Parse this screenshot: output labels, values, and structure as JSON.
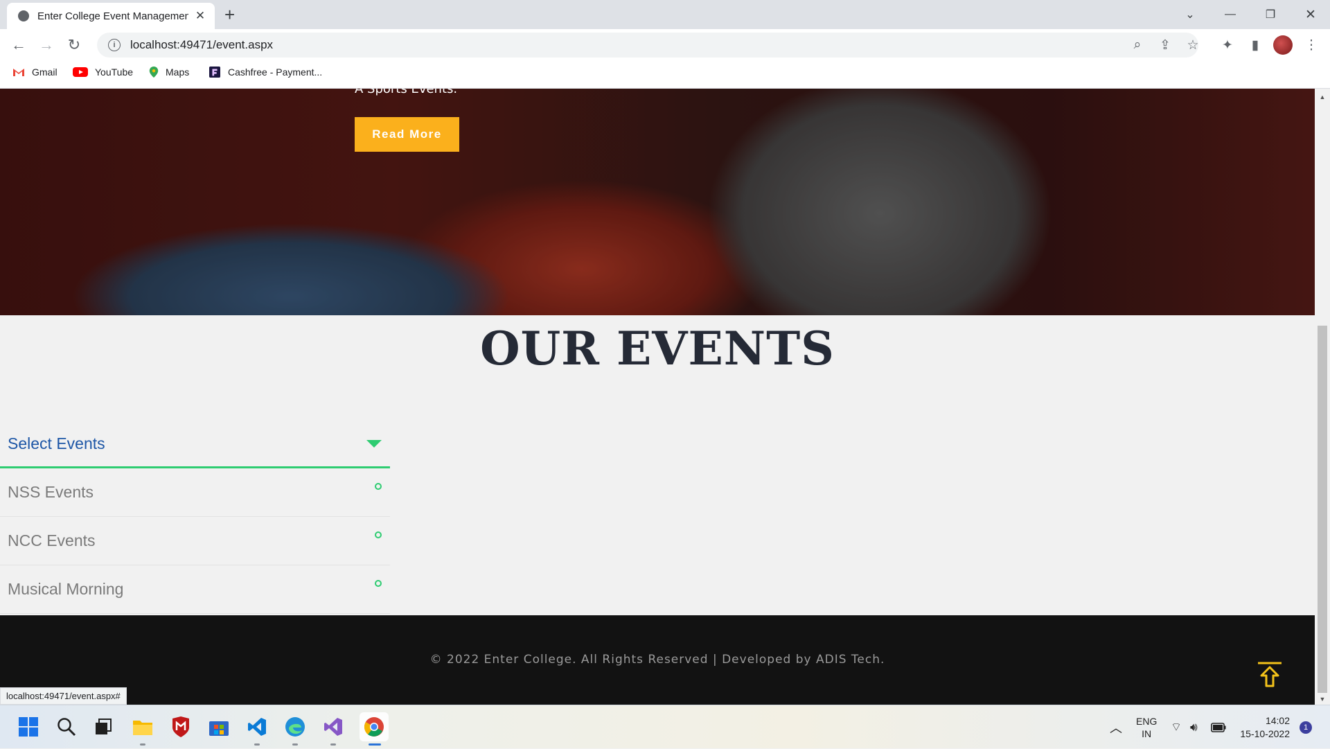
{
  "browser": {
    "tab_title": "Enter College Event Managemen",
    "url": "localhost:49471/event.aspx",
    "bookmarks": [
      {
        "label": "Gmail",
        "icon": "gmail-icon"
      },
      {
        "label": "YouTube",
        "icon": "youtube-icon"
      },
      {
        "label": "Maps",
        "icon": "maps-icon"
      },
      {
        "label": "Cashfree - Payment...",
        "icon": "cashfree-icon"
      }
    ],
    "status_url": "localhost:49471/event.aspx#"
  },
  "hero": {
    "subtitle": "A Sports Events.",
    "read_more_label": "Read More"
  },
  "events": {
    "heading": "OUR EVENTS",
    "select_label": "Select Events",
    "items": [
      "NSS Events",
      "NCC Events",
      "Musical Morning"
    ]
  },
  "footer": {
    "copyright": "© 2022 Enter College. All Rights Reserved | Developed by ADIS Tech."
  },
  "taskbar": {
    "lang_top": "ENG",
    "lang_bottom": "IN",
    "time": "14:02",
    "date": "15-10-2022",
    "notification_count": "1"
  },
  "colors": {
    "accent_green": "#2ecc71",
    "button_yellow": "#fbb01c",
    "select_blue": "#1d56a6",
    "footer_bg": "#121212"
  }
}
